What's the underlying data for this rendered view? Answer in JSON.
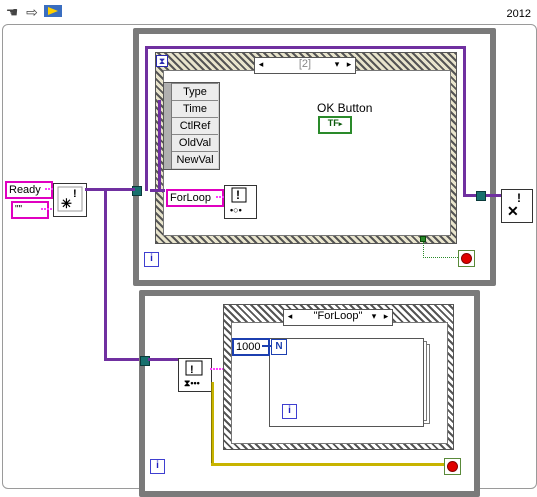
{
  "toolbar": {
    "icons": [
      "hand-icon",
      "run-arrow-icon",
      "highlight-execution-icon"
    ]
  },
  "version_label": "2012",
  "top_case": {
    "selector_value": "[2]",
    "event_data_rows": [
      "Type",
      "Time",
      "CtlRef",
      "OldVal",
      "NewVal"
    ],
    "control_label": "OK Button",
    "bool_terminal": "TF",
    "string_constant": "ForLoop",
    "iteration_label": "i"
  },
  "left": {
    "ready_constant": "Ready",
    "empty_constant": "\"\""
  },
  "bottom_case": {
    "selector_value": "\"ForLoop\"",
    "count_constant": "1000",
    "count_terminal": "N",
    "inner_iteration_label": "i",
    "outer_iteration_label": "i"
  }
}
